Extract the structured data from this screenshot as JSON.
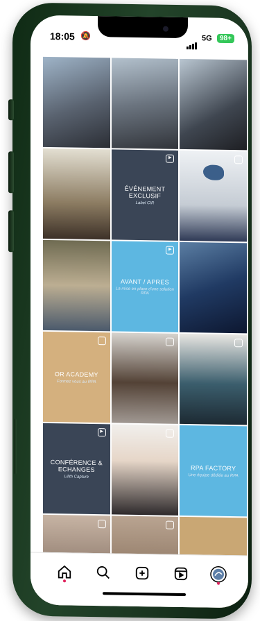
{
  "status_bar": {
    "time": "18:05",
    "network": "5G",
    "battery": "98+"
  },
  "posts": [
    {
      "kind": "photo",
      "style": "p1",
      "badge": ""
    },
    {
      "kind": "photo",
      "style": "p2",
      "badge": ""
    },
    {
      "kind": "photo",
      "style": "p3",
      "badge": ""
    },
    {
      "kind": "photo",
      "style": "p4",
      "badge": ""
    },
    {
      "kind": "graphic",
      "style": "navy",
      "badge": "reel",
      "title": "ÉVÉNEMENT EXCLUSIF",
      "subtitle": "Label CIR"
    },
    {
      "kind": "logo",
      "style": "p-logo",
      "badge": "carousel"
    },
    {
      "kind": "photo",
      "style": "p6",
      "badge": ""
    },
    {
      "kind": "graphic",
      "style": "sky",
      "badge": "reel",
      "title": "AVANT / APRES",
      "subtitle": "La mise en place d'une solution RPA"
    },
    {
      "kind": "photo",
      "style": "p7",
      "badge": ""
    },
    {
      "kind": "graphic",
      "style": "sand",
      "badge": "carousel",
      "title": "OR ACADEMY",
      "subtitle": "Formez vous au RPA"
    },
    {
      "kind": "photo",
      "style": "p8",
      "badge": "carousel"
    },
    {
      "kind": "photo",
      "style": "p9",
      "badge": "carousel"
    },
    {
      "kind": "graphic",
      "style": "navy",
      "badge": "reel",
      "title": "CONFÉRENCE & ECHANGES",
      "subtitle": "Lilith Capture"
    },
    {
      "kind": "photo",
      "style": "p10",
      "badge": "carousel"
    },
    {
      "kind": "graphic",
      "style": "sky",
      "badge": "",
      "title": "RPA FACTORY",
      "subtitle": "Une équipe dédiée au RPA"
    },
    {
      "kind": "photo",
      "style": "p11",
      "badge": "carousel"
    },
    {
      "kind": "photo",
      "style": "p12",
      "badge": "carousel"
    },
    {
      "kind": "graphic",
      "style": "sand2",
      "badge": ""
    }
  ],
  "tabbar": {
    "items": [
      "home-icon",
      "search-icon",
      "create-post-icon",
      "reels-icon",
      "profile-avatar"
    ]
  },
  "colors": {
    "phone_frame": "#1f3b24",
    "navy_tile": "#3a4556",
    "sky_tile": "#5db7e1",
    "sand_tile": "#d4b07e",
    "notification_dot": "#e0245e"
  }
}
